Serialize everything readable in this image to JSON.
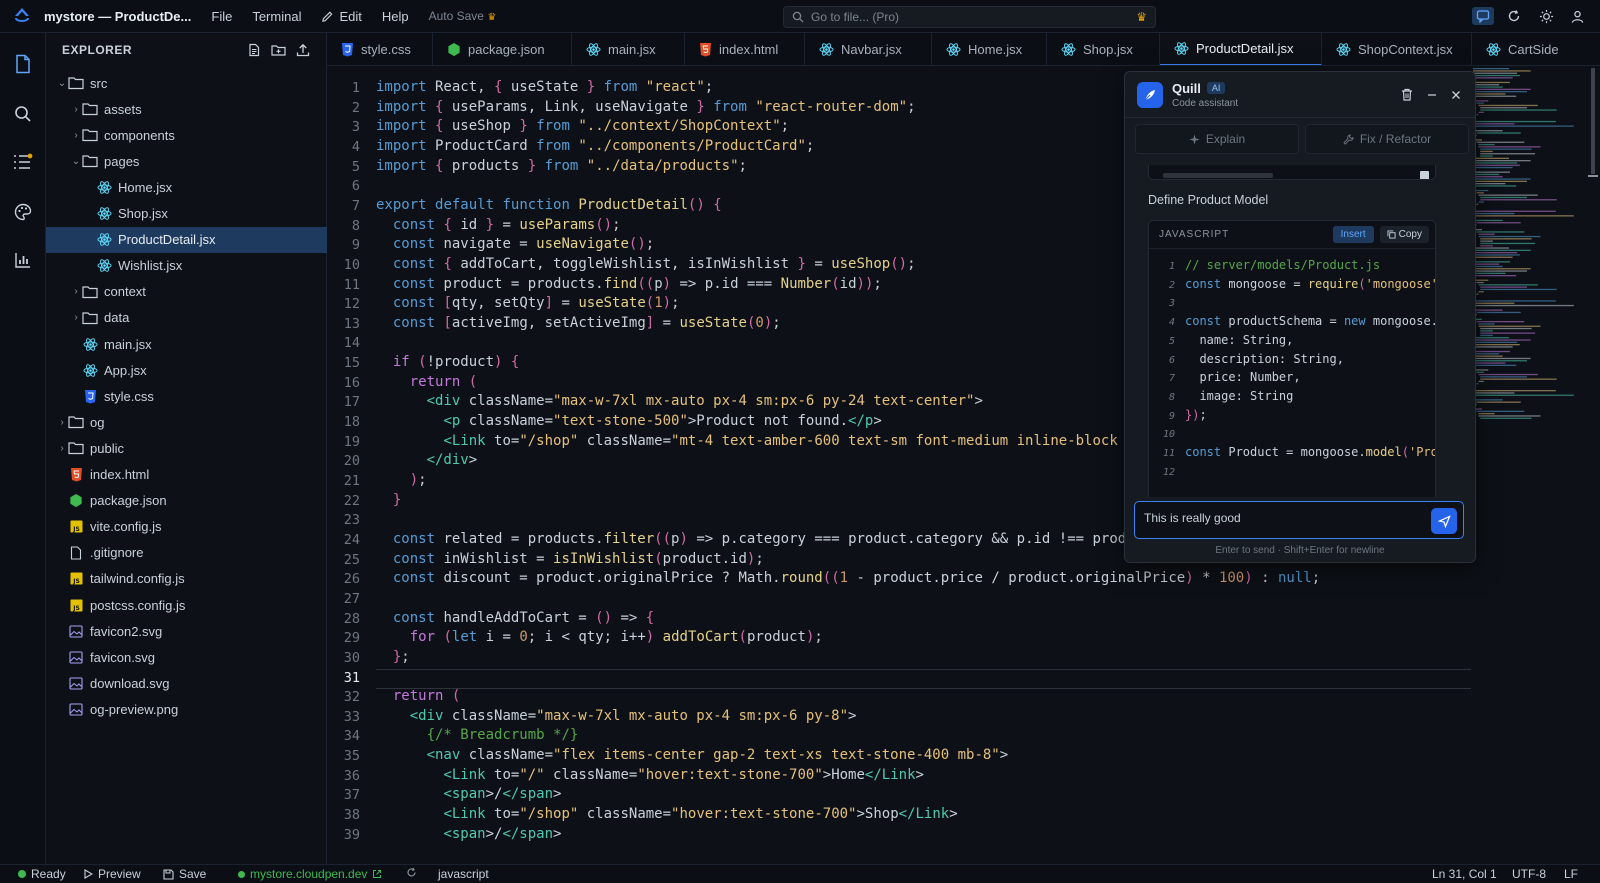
{
  "titlebar": {
    "app_title": "mystore — ProductDe...",
    "menus": [
      "File",
      "Terminal",
      "Edit",
      "Help"
    ],
    "autosave": "Auto Save",
    "search_placeholder": "Go to file... (Pro)"
  },
  "explorer": {
    "title": "EXPLORER",
    "items": [
      {
        "label": "src",
        "type": "folder",
        "open": true,
        "depth": 0
      },
      {
        "label": "assets",
        "type": "folder",
        "open": false,
        "depth": 1
      },
      {
        "label": "components",
        "type": "folder",
        "open": false,
        "depth": 1
      },
      {
        "label": "pages",
        "type": "folder",
        "open": true,
        "depth": 1
      },
      {
        "label": "Home.jsx",
        "type": "react",
        "depth": 2
      },
      {
        "label": "Shop.jsx",
        "type": "react",
        "depth": 2
      },
      {
        "label": "ProductDetail.jsx",
        "type": "react",
        "depth": 2,
        "selected": true
      },
      {
        "label": "Wishlist.jsx",
        "type": "react",
        "depth": 2
      },
      {
        "label": "context",
        "type": "folder",
        "open": false,
        "depth": 1
      },
      {
        "label": "data",
        "type": "folder",
        "open": false,
        "depth": 1
      },
      {
        "label": "main.jsx",
        "type": "react",
        "depth": 1
      },
      {
        "label": "App.jsx",
        "type": "react",
        "depth": 1
      },
      {
        "label": "style.css",
        "type": "css",
        "depth": 1
      },
      {
        "label": "og",
        "type": "folder",
        "open": false,
        "depth": 0
      },
      {
        "label": "public",
        "type": "folder",
        "open": false,
        "depth": 0
      },
      {
        "label": "index.html",
        "type": "html",
        "depth": 0
      },
      {
        "label": "package.json",
        "type": "node",
        "depth": 0
      },
      {
        "label": "vite.config.js",
        "type": "js",
        "depth": 0
      },
      {
        "label": ".gitignore",
        "type": "file",
        "depth": 0
      },
      {
        "label": "tailwind.config.js",
        "type": "js",
        "depth": 0
      },
      {
        "label": "postcss.config.js",
        "type": "js",
        "depth": 0
      },
      {
        "label": "favicon2.svg",
        "type": "image",
        "depth": 0
      },
      {
        "label": "favicon.svg",
        "type": "image",
        "depth": 0
      },
      {
        "label": "download.svg",
        "type": "image",
        "depth": 0
      },
      {
        "label": "og-preview.png",
        "type": "image",
        "depth": 0
      }
    ]
  },
  "tabs": [
    {
      "label": "style.css",
      "type": "css"
    },
    {
      "label": "package.json",
      "type": "node"
    },
    {
      "label": "main.jsx",
      "type": "react"
    },
    {
      "label": "index.html",
      "type": "html"
    },
    {
      "label": "Navbar.jsx",
      "type": "react"
    },
    {
      "label": "Home.jsx",
      "type": "react"
    },
    {
      "label": "Shop.jsx",
      "type": "react"
    },
    {
      "label": "ProductDetail.jsx",
      "type": "react",
      "active": true
    },
    {
      "label": "ShopContext.jsx",
      "type": "react"
    },
    {
      "label": "CartSide",
      "type": "react"
    }
  ],
  "editor": {
    "current_line": 31,
    "lines": [
      "import React, { useState } from \"react\";",
      "import { useParams, Link, useNavigate } from \"react-router-dom\";",
      "import { useShop } from \"../context/ShopContext\";",
      "import ProductCard from \"../components/ProductCard\";",
      "import { products } from \"../data/products\";",
      "",
      "export default function ProductDetail() {",
      "  const { id } = useParams();",
      "  const navigate = useNavigate();",
      "  const { addToCart, toggleWishlist, isInWishlist } = useShop();",
      "  const product = products.find((p) => p.id === Number(id));",
      "  const [qty, setQty] = useState(1);",
      "  const [activeImg, setActiveImg] = useState(0);",
      "",
      "  if (!product) {",
      "    return (",
      "      <div className=\"max-w-7xl mx-auto px-4 sm:px-6 py-24 text-center\">",
      "        <p className=\"text-stone-500\">Product not found.</p>",
      "        <Link to=\"/shop\" className=\"mt-4 text-amber-600 text-sm font-medium inline-block hove",
      "      </div>",
      "    );",
      "  }",
      "",
      "  const related = products.filter((p) => p.category === product.category && p.id !== product",
      "  const inWishlist = isInWishlist(product.id);",
      "  const discount = product.originalPrice ? Math.round((1 - product.price / product.originalPrice) * 100) : null;",
      "",
      "  const handleAddToCart = () => {",
      "    for (let i = 0; i < qty; i++) addToCart(product);",
      "  };",
      "",
      "  return (",
      "    <div className=\"max-w-7xl mx-auto px-4 sm:px-6 py-8\">",
      "      {/* Breadcrumb */}",
      "      <nav className=\"flex items-center gap-2 text-xs text-stone-400 mb-8\">",
      "        <Link to=\"/\" className=\"hover:text-stone-700\">Home</Link>",
      "        <span>/</span>",
      "        <Link to=\"/shop\" className=\"hover:text-stone-700\">Shop</Link>",
      "        <span>/</span>"
    ]
  },
  "quill": {
    "name": "Quill",
    "badge": "AI",
    "subtitle": "Code assistant",
    "explain_label": "Explain",
    "fix_label": "Fix / Refactor",
    "section_title": "Define Product Model",
    "code_lang": "JAVASCRIPT",
    "insert_label": "Insert",
    "copy_label": "Copy",
    "code_lines": [
      "// server/models/Product.js",
      "const mongoose = require('mongoose'",
      "",
      "const productSchema = new mongoose.",
      "  name: String,",
      "  description: String,",
      "  price: Number,",
      "  image: String",
      "});",
      "",
      "const Product = mongoose.model('Pro",
      ""
    ],
    "input_value": "This is really good",
    "hint": "Enter to send · Shift+Enter for newline"
  },
  "statusbar": {
    "ready": "Ready",
    "preview": "Preview",
    "save": "Save",
    "domain": "mystore.cloudpen.dev",
    "language": "javascript",
    "position": "Ln 31, Col 1",
    "encoding": "UTF-8",
    "eol": "LF"
  },
  "colors": {
    "accent": "#3b82f6",
    "selected_row": "#1e3a5f",
    "ready_dot": "#3fb950"
  }
}
